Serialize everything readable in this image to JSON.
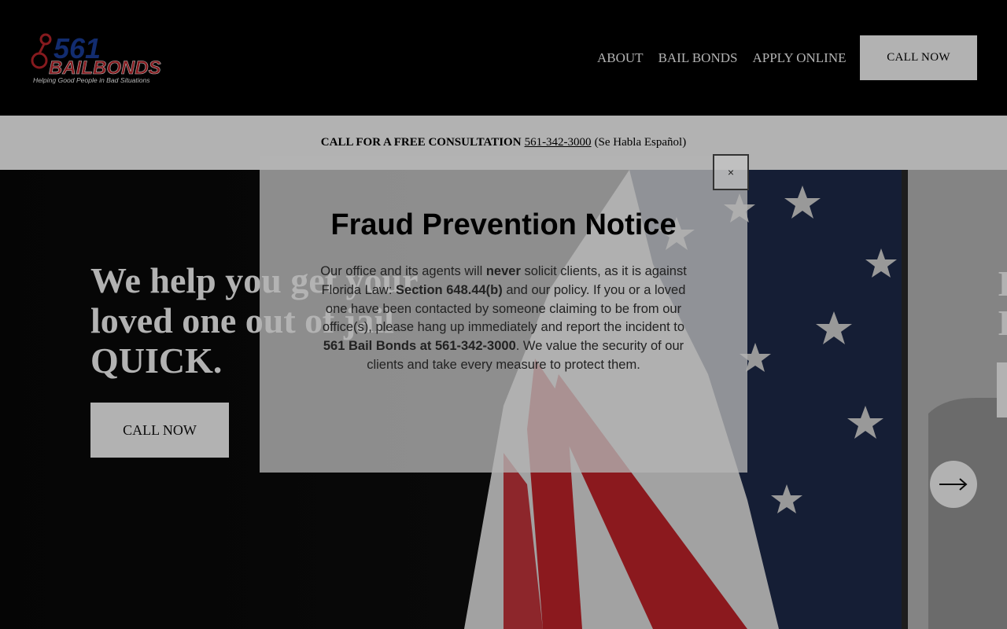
{
  "logo": {
    "number": "561",
    "name": "BAILBONDS",
    "tagline": "Helping Good People in Bad Situations"
  },
  "nav": {
    "items": [
      {
        "label": "ABOUT"
      },
      {
        "label": "BAIL BONDS"
      },
      {
        "label": "APPLY ONLINE"
      }
    ],
    "call_label": "CALL NOW"
  },
  "consult": {
    "lead": "CALL FOR A FREE CONSULTATION",
    "phone": "561-342-3000",
    "note": "(Se Habla Español)"
  },
  "hero": {
    "headline_line1": "We help you get your",
    "headline_line2": "loved one out of jail",
    "headline_line3": "QUICK.",
    "cta_label": "CALL NOW",
    "next_icon": "arrow-right-icon",
    "peek_line1": "I",
    "peek_line2": "I"
  },
  "modal": {
    "title": "Fraud Prevention Notice",
    "p1": "Our office and its agents will ",
    "p1_bold": "never",
    "p2": " solicit clients, as it is against Florida Law: ",
    "p2_bold": "Section 648.44(b)",
    "p3": " and our policy. If you or a loved one have been contacted by someone claiming to be from our office(s), please hang up immediately and report the incident to ",
    "p3_bold": "561 Bail Bonds at 561-342-3000",
    "p4": ". We value the security of our clients and take every measure to protect them.",
    "close_label": "×"
  },
  "colors": {
    "header_bg": "#000000",
    "logo_blue": "#1b3fa0",
    "logo_red": "#c0262c",
    "flag_red": "#c8242b",
    "flag_navy": "#1f2c4d"
  }
}
